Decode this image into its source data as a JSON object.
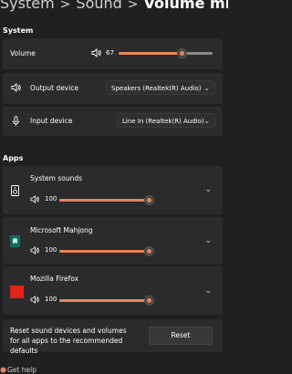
{
  "breadcrumb": {
    "items": [
      "System",
      "Sound"
    ],
    "current": "Volume mixer"
  },
  "system_section": {
    "label": "System",
    "volume": {
      "label": "Volume",
      "value": "67",
      "level": 0.67
    },
    "output": {
      "label": "Output device",
      "selected": "Speakers (Realtek(R) Audio)"
    },
    "input": {
      "label": "Input device",
      "selected": "Line In (Realtek(R) Audio)"
    }
  },
  "apps_section": {
    "label": "Apps",
    "apps": [
      {
        "name": "System sounds",
        "value": "100",
        "level": 1.0
      },
      {
        "name": "Microsoft Mahjong",
        "value": "100",
        "level": 1.0
      },
      {
        "name": "Mozilla Firefox",
        "value": "100",
        "level": 1.0
      }
    ]
  },
  "reset": {
    "text": "Reset sound devices and volumes for all apps to the recommended defaults",
    "button": "Reset"
  },
  "help": {
    "label": "Get help"
  },
  "colors": {
    "accent": "#e8845a",
    "background": "#202020",
    "card": "#2b2b2b"
  }
}
